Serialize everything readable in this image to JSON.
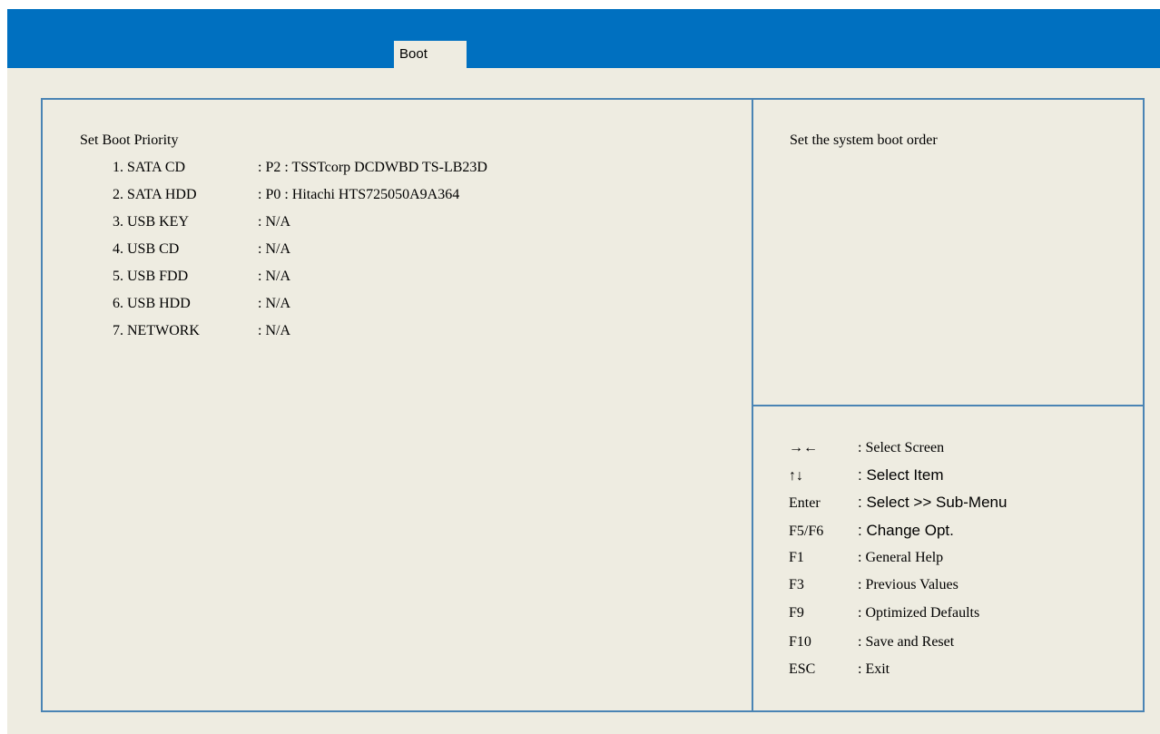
{
  "tabs": [
    {
      "label": "Boot"
    }
  ],
  "main": {
    "section_title": "Set Boot Priority",
    "boot_items": [
      {
        "label": "1. SATA CD",
        "value": ": P2 : TSSTcorp DCDWBD TS-LB23D"
      },
      {
        "label": "2. SATA HDD",
        "value": ": P0 : Hitachi HTS725050A9A364"
      },
      {
        "label": "3. USB KEY",
        "value": ": N/A"
      },
      {
        "label": "4. USB CD",
        "value": ": N/A"
      },
      {
        "label": "5. USB FDD",
        "value": ": N/A"
      },
      {
        "label": "6. USB HDD",
        "value": ": N/A"
      },
      {
        "label": "7. NETWORK",
        "value": ": N/A"
      }
    ]
  },
  "help": {
    "description": "Set the system boot order"
  },
  "keys": [
    {
      "key": "→←",
      "desc": ": Select Screen"
    },
    {
      "key": "↑↓",
      "desc": ": Select Item"
    },
    {
      "key": "Enter",
      "desc": ": Select >> Sub-Menu"
    },
    {
      "key": "F5/F6",
      "desc": ": Change Opt."
    },
    {
      "key": "F1",
      "desc": ": General Help"
    },
    {
      "key": "F3",
      "desc": ": Previous Values"
    },
    {
      "key": "F9",
      "desc": ": Optimized Defaults"
    },
    {
      "key": "F10",
      "desc": ": Save and Reset"
    },
    {
      "key": "ESC",
      "desc": ": Exit"
    }
  ],
  "colors": {
    "header": "#0070c0",
    "background": "#eeece1",
    "border": "#4a84b4"
  }
}
